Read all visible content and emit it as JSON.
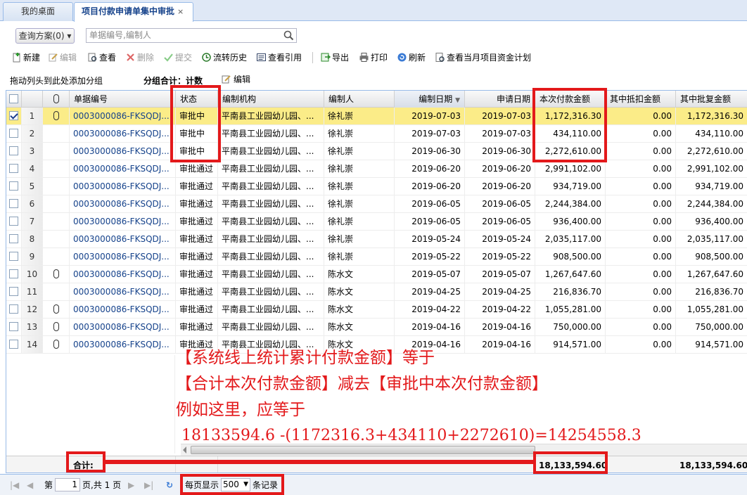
{
  "tabs": [
    {
      "label": "我的桌面"
    },
    {
      "label": "项目付款申请单集中审批",
      "close": "×"
    }
  ],
  "query": {
    "scheme_label": "查询方案(0) ▾",
    "search_placeholder": "单据编号,编制人"
  },
  "toolbar": {
    "new": "新建",
    "edit": "编辑",
    "view": "查看",
    "delete": "删除",
    "submit": "提交",
    "history": "流转历史",
    "ref": "查看引用",
    "export": "导出",
    "print": "打印",
    "refresh": "刷新",
    "plan": "查看当月项目资金计划"
  },
  "groupbar": {
    "drag_hint": "拖动列头到此处添加分组",
    "group_total": "分组合计：计数",
    "edit": "编辑"
  },
  "columns": {
    "doc_no": "单据编号",
    "status": "状态",
    "org": "编制机构",
    "preparer": "编制人",
    "prep_date": "编制日期",
    "apply_date": "申请日期",
    "amount": "本次付款金额",
    "deduct": "其中抵扣金额",
    "recovered": "其中批复金额"
  },
  "rows": [
    {
      "n": "1",
      "checked": true,
      "attach": true,
      "doc": "0003000086-FKSQDJ...",
      "status": "审批中",
      "org": "平南县工业园幼儿园、...",
      "prep": "徐礼崇",
      "pdate": "2019-07-03",
      "adate": "2019-07-03",
      "amount": "1,172,316.30",
      "deduct": "0.00",
      "rec": "1,172,316.30"
    },
    {
      "n": "2",
      "checked": false,
      "attach": false,
      "doc": "0003000086-FKSQDJ...",
      "status": "审批中",
      "org": "平南县工业园幼儿园、...",
      "prep": "徐礼崇",
      "pdate": "2019-07-03",
      "adate": "2019-07-03",
      "amount": "434,110.00",
      "deduct": "0.00",
      "rec": "434,110.00"
    },
    {
      "n": "3",
      "checked": false,
      "attach": false,
      "doc": "0003000086-FKSQDJ...",
      "status": "审批中",
      "org": "平南县工业园幼儿园、...",
      "prep": "徐礼崇",
      "pdate": "2019-06-30",
      "adate": "2019-06-30",
      "amount": "2,272,610.00",
      "deduct": "0.00",
      "rec": "2,272,610.00"
    },
    {
      "n": "4",
      "checked": false,
      "attach": false,
      "doc": "0003000086-FKSQDJ...",
      "status": "审批通过",
      "org": "平南县工业园幼儿园、...",
      "prep": "徐礼崇",
      "pdate": "2019-06-20",
      "adate": "2019-06-20",
      "amount": "2,991,102.00",
      "deduct": "0.00",
      "rec": "2,991,102.00"
    },
    {
      "n": "5",
      "checked": false,
      "attach": false,
      "doc": "0003000086-FKSQDJ...",
      "status": "审批通过",
      "org": "平南县工业园幼儿园、...",
      "prep": "徐礼崇",
      "pdate": "2019-06-20",
      "adate": "2019-06-20",
      "amount": "934,719.00",
      "deduct": "0.00",
      "rec": "934,719.00"
    },
    {
      "n": "6",
      "checked": false,
      "attach": false,
      "doc": "0003000086-FKSQDJ...",
      "status": "审批通过",
      "org": "平南县工业园幼儿园、...",
      "prep": "徐礼崇",
      "pdate": "2019-06-05",
      "adate": "2019-06-05",
      "amount": "2,244,384.00",
      "deduct": "0.00",
      "rec": "2,244,384.00"
    },
    {
      "n": "7",
      "checked": false,
      "attach": false,
      "doc": "0003000086-FKSQDJ...",
      "status": "审批通过",
      "org": "平南县工业园幼儿园、...",
      "prep": "徐礼崇",
      "pdate": "2019-06-05",
      "adate": "2019-06-05",
      "amount": "936,400.00",
      "deduct": "0.00",
      "rec": "936,400.00"
    },
    {
      "n": "8",
      "checked": false,
      "attach": false,
      "doc": "0003000086-FKSQDJ...",
      "status": "审批通过",
      "org": "平南县工业园幼儿园、...",
      "prep": "徐礼崇",
      "pdate": "2019-05-24",
      "adate": "2019-05-24",
      "amount": "2,035,117.00",
      "deduct": "0.00",
      "rec": "2,035,117.00"
    },
    {
      "n": "9",
      "checked": false,
      "attach": false,
      "doc": "0003000086-FKSQDJ...",
      "status": "审批通过",
      "org": "平南县工业园幼儿园、...",
      "prep": "徐礼崇",
      "pdate": "2019-05-22",
      "adate": "2019-05-22",
      "amount": "908,500.00",
      "deduct": "0.00",
      "rec": "908,500.00"
    },
    {
      "n": "10",
      "checked": false,
      "attach": true,
      "doc": "0003000086-FKSQDJ...",
      "status": "审批通过",
      "org": "平南县工业园幼儿园、...",
      "prep": "陈水文",
      "pdate": "2019-05-07",
      "adate": "2019-05-07",
      "amount": "1,267,647.60",
      "deduct": "0.00",
      "rec": "1,267,647.60"
    },
    {
      "n": "11",
      "checked": false,
      "attach": false,
      "doc": "0003000086-FKSQDJ...",
      "status": "审批通过",
      "org": "平南县工业园幼儿园、...",
      "prep": "陈水文",
      "pdate": "2019-04-25",
      "adate": "2019-04-25",
      "amount": "216,836.70",
      "deduct": "0.00",
      "rec": "216,836.70"
    },
    {
      "n": "12",
      "checked": false,
      "attach": true,
      "doc": "0003000086-FKSQDJ...",
      "status": "审批通过",
      "org": "平南县工业园幼儿园、...",
      "prep": "陈水文",
      "pdate": "2019-04-22",
      "adate": "2019-04-22",
      "amount": "1,055,281.00",
      "deduct": "0.00",
      "rec": "1,055,281.00"
    },
    {
      "n": "13",
      "checked": false,
      "attach": true,
      "doc": "0003000086-FKSQDJ...",
      "status": "审批通过",
      "org": "平南县工业园幼儿园、...",
      "prep": "陈水文",
      "pdate": "2019-04-16",
      "adate": "2019-04-16",
      "amount": "750,000.00",
      "deduct": "0.00",
      "rec": "750,000.00"
    },
    {
      "n": "14",
      "checked": false,
      "attach": true,
      "doc": "0003000086-FKSQDJ...",
      "status": "审批通过",
      "org": "平南县工业园幼儿园、...",
      "prep": "陈水文",
      "pdate": "2019-04-16",
      "adate": "2019-04-16",
      "amount": "914,571.00",
      "deduct": "0.00",
      "rec": "914,571.00"
    }
  ],
  "summary": {
    "label": "合计:",
    "amount": "18,133,594.60",
    "rec": "18,133,594.60"
  },
  "pager": {
    "page_prefix": "第",
    "page_value": "1",
    "page_suffix": "页,共 1 页",
    "per_page_prefix": "每页显示",
    "per_page_value": "500",
    "per_page_suffix": "条记录"
  },
  "annotation": {
    "line1": "【系统线上统计累计付款金额】等于",
    "line2": "【合计本次付款金额】减去【审批中本次付款金额】",
    "line3": " 例如这里，应等于",
    "line4": "18133594.6 -(1172316.3+434110+2272610)=14254558.3"
  },
  "colors": {
    "accent": "#15428b",
    "annotation_red": "#e3191b",
    "selected_row": "#fbec88"
  }
}
